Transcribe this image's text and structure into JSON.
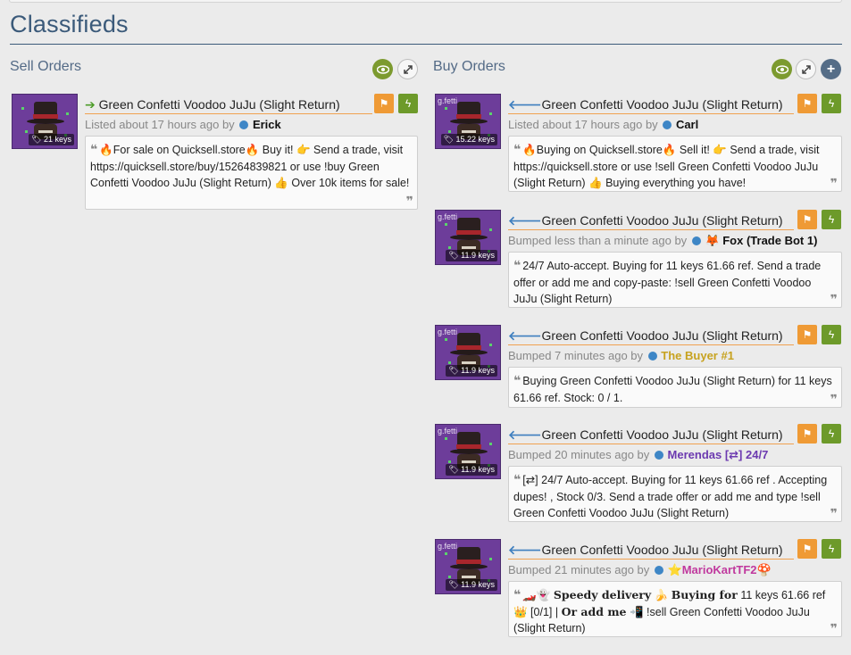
{
  "page_title": "Classifieds",
  "sell": {
    "title": "Sell Orders",
    "listings": [
      {
        "item": "Green Confetti Voodoo JuJu (Slight Return)",
        "price": "21 keys",
        "tag": "",
        "meta_prefix": "Listed about 17 hours ago by",
        "user": "Erick",
        "comment": "🔥For sale on Quicksell.store🔥 Buy it! 👉 Send a trade, visit https://quicksell.store/buy/15264839821 or use !buy Green Confetti Voodoo JuJu (Slight Return) 👍 Over 10k items for sale!"
      }
    ]
  },
  "buy": {
    "title": "Buy Orders",
    "listings": [
      {
        "item": "Green Confetti Voodoo JuJu (Slight Return)",
        "price": "15.22 keys",
        "tag": "g.fetti",
        "meta_prefix": "Listed about 17 hours ago by",
        "user": "Carl",
        "comment": "🔥Buying on Quicksell.store🔥 Sell it! 👉 Send a trade, visit https://quicksell.store or use !sell Green Confetti Voodoo JuJu (Slight Return) 👍 Buying everything you have!"
      },
      {
        "item": "Green Confetti Voodoo JuJu (Slight Return)",
        "price": "11.9 keys",
        "tag": "g.fetti",
        "meta_prefix": "Bumped less than a minute ago by",
        "user": "🦊 Fox (Trade Bot 1)",
        "comment": "24/7 Auto-accept. Buying for 11 keys 61.66 ref. Send a trade offer or add me and copy-paste: !sell Green Confetti Voodoo JuJu (Slight Return)"
      },
      {
        "item": "Green Confetti Voodoo JuJu (Slight Return)",
        "price": "11.9 keys",
        "tag": "g.fetti",
        "meta_prefix": "Bumped 7 minutes ago by",
        "user": "The Buyer #1",
        "comment": "Buying Green Confetti Voodoo JuJu (Slight Return) for 11 keys 61.66 ref. Stock: 0 / 1."
      },
      {
        "item": "Green Confetti Voodoo JuJu (Slight Return)",
        "price": "11.9 keys",
        "tag": "g.fetti",
        "meta_prefix": "Bumped 20 minutes ago by",
        "user": "Merendas [⇄] 24/7",
        "comment": "[⇄] 24/7 Auto-accept. Buying for 11 keys 61.66 ref . Accepting dupes! , Stock 0/3. Send a trade offer or add me and type !sell Green Confetti Voodoo JuJu (Slight Return)"
      },
      {
        "item": "Green Confetti Voodoo JuJu (Slight Return)",
        "price": "11.9 keys",
        "tag": "g.fetti",
        "meta_prefix": "Bumped 21 minutes ago by",
        "user": "⭐MarioKartTF2🍄",
        "comment_parts": {
          "icons": "🏎️👻",
          "bold1": "Speedy delivery",
          "banana": "🍌",
          "bold2": "Buying for",
          "text1": " 11 keys 61.66 ref",
          "crown": "👑",
          "text2": " [0/1] | ",
          "bold3": "Or add me",
          "phone": "📲",
          "text3": " !sell Green Confetti Voodoo JuJu (Slight Return)"
        }
      }
    ]
  },
  "icons": {
    "eye": "eye-icon",
    "expand": "expand-icon",
    "plus": "plus-icon",
    "flag": "flag-icon",
    "bolt": "lightning-icon",
    "quote": "quote-icon",
    "arrow_sell": "arrow-right-icon",
    "arrow_buy": "arrow-left-icon"
  },
  "colors": {
    "accent": "#3b5a7a",
    "sell_arrow": "#4d9d2a",
    "buy_arrow": "#3f7fbf",
    "flag_button": "#ef9a35",
    "bolt_button": "#6d9a2a",
    "unusual_quality": "#6d3d9a"
  }
}
